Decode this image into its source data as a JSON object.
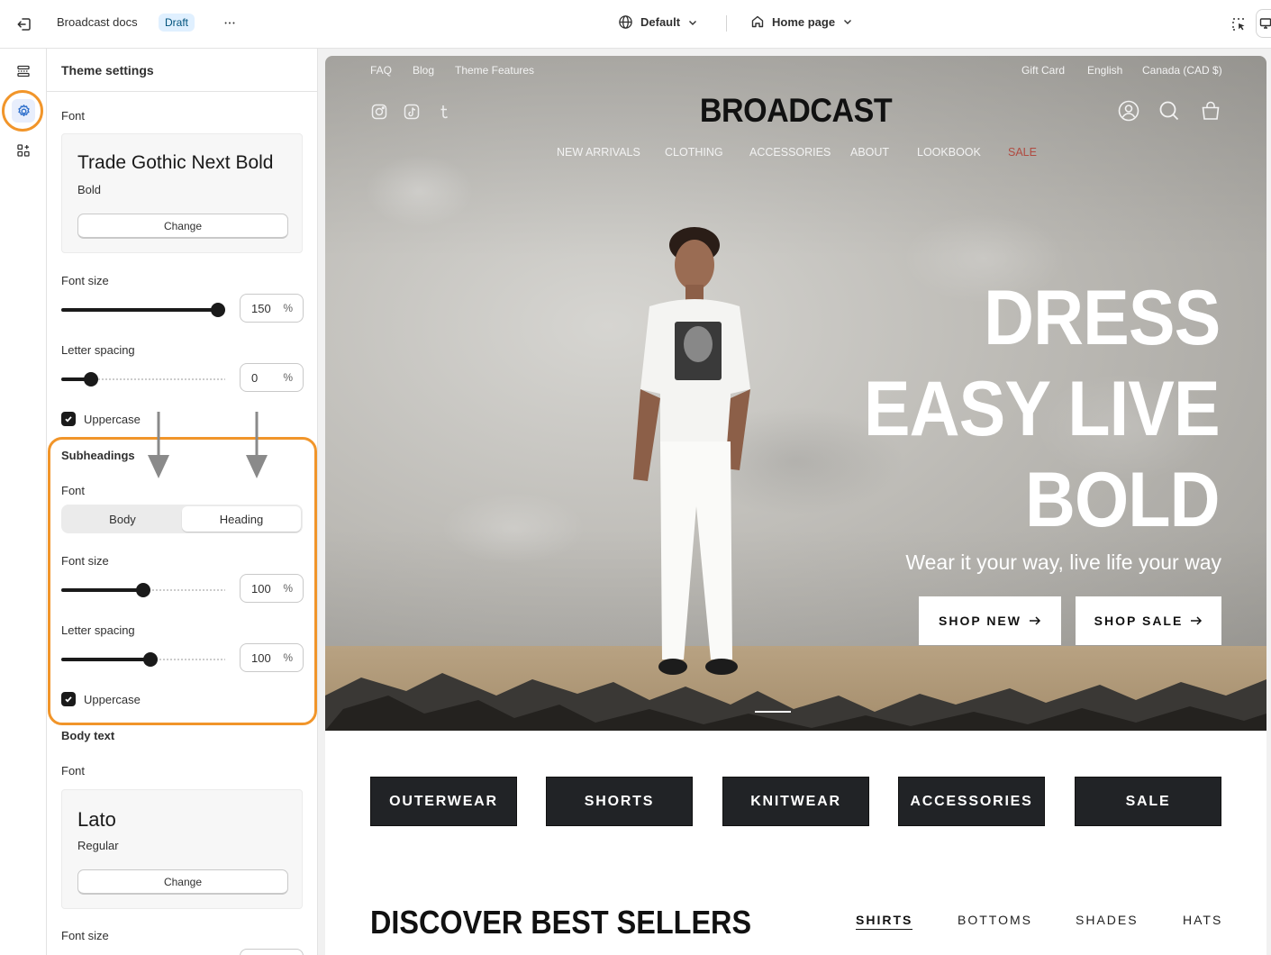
{
  "topbar": {
    "store_name": "Broadcast docs",
    "status_badge": "Draft",
    "more_label": "•••",
    "theme_select": "Default",
    "page_select": "Home page"
  },
  "rail": {
    "items": [
      {
        "icon": "sections-icon"
      },
      {
        "icon": "gear-icon",
        "active": true
      },
      {
        "icon": "apps-icon"
      }
    ]
  },
  "panel": {
    "title": "Theme settings",
    "headings_font": {
      "label": "Font",
      "name": "Trade Gothic Next Bold",
      "style": "Bold",
      "change_label": "Change"
    },
    "headings_size": {
      "label": "Font size",
      "value": "150",
      "unit": "%",
      "fraction": 1.0
    },
    "headings_spacing": {
      "label": "Letter spacing",
      "value": "0",
      "unit": "%",
      "fraction": 0.15
    },
    "headings_uppercase": {
      "label": "Uppercase",
      "checked": true
    },
    "subheadings": {
      "title": "Subheadings",
      "font_label": "Font",
      "options": [
        "Body",
        "Heading"
      ],
      "selected": "Heading",
      "size": {
        "label": "Font size",
        "value": "100",
        "unit": "%",
        "fraction": 0.5
      },
      "spacing": {
        "label": "Letter spacing",
        "value": "100",
        "unit": "%",
        "fraction": 0.55
      },
      "uppercase": {
        "label": "Uppercase",
        "checked": true
      }
    },
    "body_text": {
      "title": "Body text",
      "font_label": "Font",
      "name": "Lato",
      "style": "Regular",
      "change_label": "Change",
      "size_label": "Font size"
    }
  },
  "preview": {
    "utility_left": [
      "FAQ",
      "Blog",
      "Theme Features"
    ],
    "utility_right": [
      "Gift Card",
      "English",
      "Canada (CAD $)"
    ],
    "logo": "BROADCAST",
    "nav": [
      "NEW ARRIVALS",
      "CLOTHING",
      "ACCESSORIES",
      "ABOUT",
      "LOOKBOOK",
      "SALE"
    ],
    "hero_lines": [
      "DRESS",
      "EASY LIVE",
      "BOLD"
    ],
    "hero_subtitle": "Wear it your way, live life your way",
    "hero_buttons": [
      "SHOP NEW",
      "SHOP SALE"
    ],
    "categories": [
      "OUTERWEAR",
      "SHORTS",
      "KNITWEAR",
      "ACCESSORIES",
      "SALE"
    ],
    "best_sellers_title": "DISCOVER BEST SELLERS",
    "best_sellers_tabs": [
      "SHIRTS",
      "BOTTOMS",
      "SHADES",
      "HATS"
    ]
  },
  "colors": {
    "accent_highlight": "#f1952a",
    "sale_red": "#b04b41",
    "category_button": "#212326"
  }
}
